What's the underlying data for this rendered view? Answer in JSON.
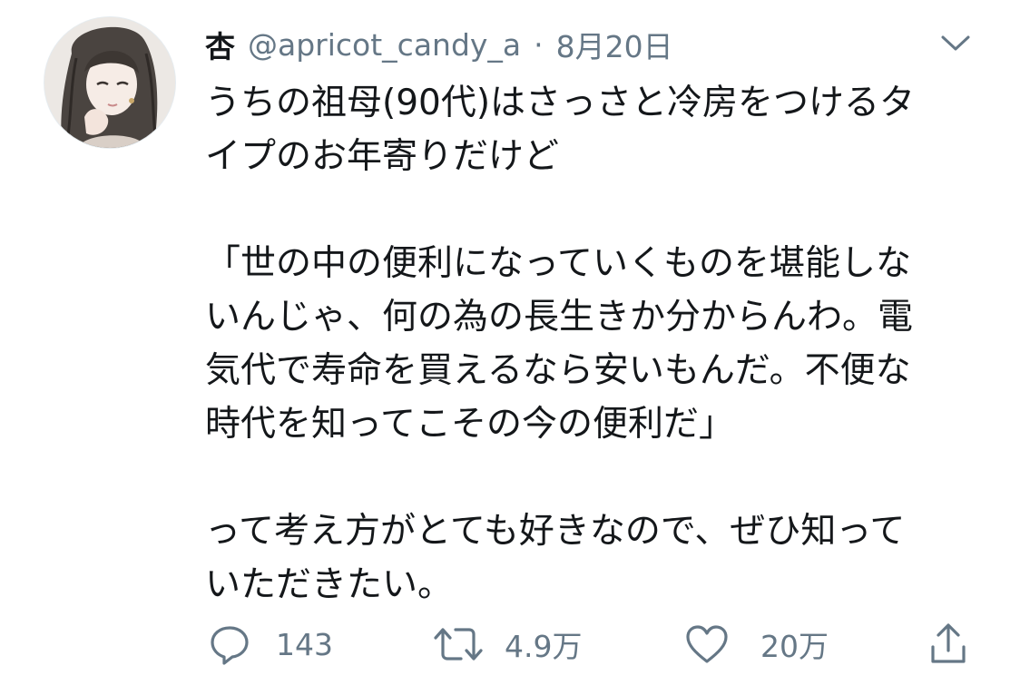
{
  "tweet": {
    "author": {
      "display_name": "杏",
      "handle": "@apricot_candy_a",
      "separator": "·",
      "date": "8月20日"
    },
    "text_lines": [
      "うちの祖母(90代)はさっさと冷房をつけるタ",
      "イプのお年寄りだけど",
      "",
      "「世の中の便利になっていくものを堪能しな",
      "いんじゃ、何の為の長生きか分からんわ。電",
      "気代で寿命を買えるなら安いもんだ。不便な",
      "時代を知ってこその今の便利だ」",
      "",
      "って考え方がとても好きなので、ぜひ知って",
      "いただきたい。"
    ],
    "actions": {
      "reply": {
        "icon": "reply-icon",
        "count": "143"
      },
      "retweet": {
        "icon": "retweet-icon",
        "count": "4.9万"
      },
      "like": {
        "icon": "heart-icon",
        "count": "20万"
      },
      "share": {
        "icon": "share-icon"
      }
    },
    "menu_icon": "chevron-down-icon"
  },
  "colors": {
    "text": "#14171a",
    "secondary": "#657786",
    "icon": "#657786"
  }
}
